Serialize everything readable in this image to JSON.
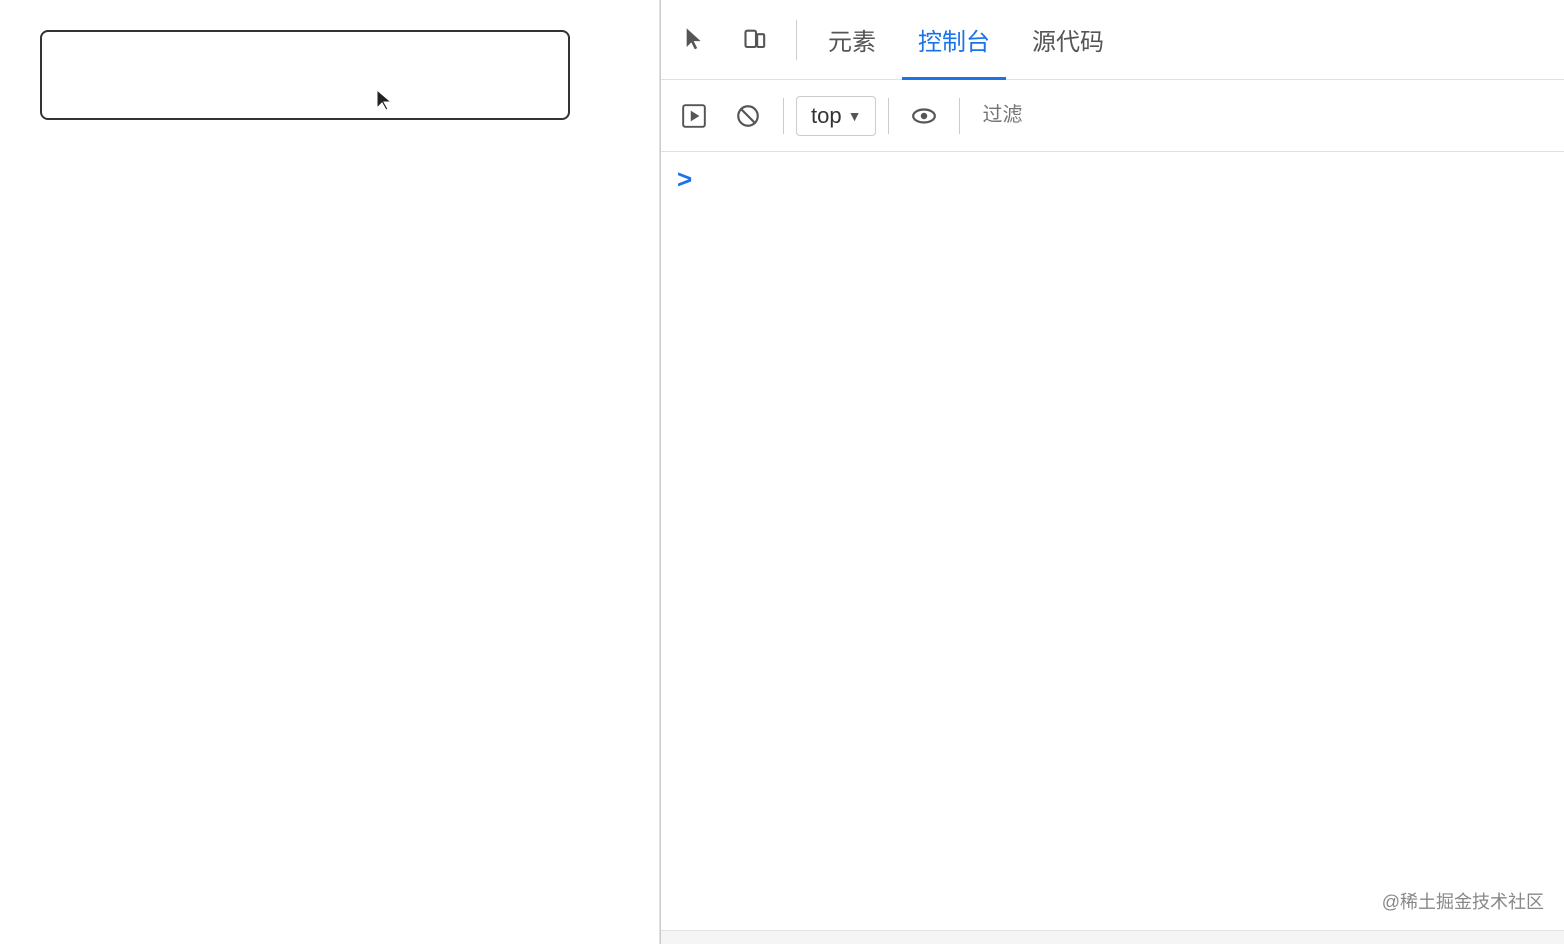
{
  "left_panel": {
    "input_box": {
      "placeholder": ""
    }
  },
  "devtools": {
    "tabs": [
      {
        "id": "elements",
        "label": "元素",
        "active": false
      },
      {
        "id": "console",
        "label": "控制台",
        "active": true
      },
      {
        "id": "sources",
        "label": "源代码",
        "active": false
      }
    ],
    "toolbar": {
      "top_selector": {
        "value": "top",
        "dropdown_label": "▼"
      },
      "filter_placeholder": "过滤"
    },
    "console_prompt_chevron": ">",
    "watermark": "@稀土掘金技术社区"
  }
}
